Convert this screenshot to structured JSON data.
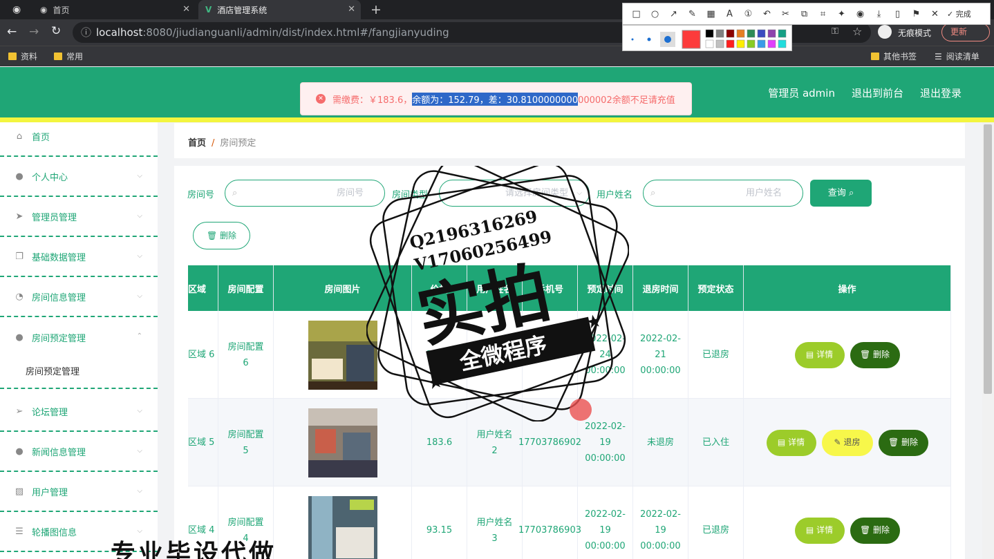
{
  "browser": {
    "tabs": [
      {
        "title": "首页"
      },
      {
        "title": "酒店管理系统"
      }
    ],
    "url_host": "localhost",
    "url_rest": ":8080/jiudianguanli/admin/dist/index.html#/fangjianyuding",
    "incognito_label": "无痕模式",
    "update_label": "更新",
    "bookmarks": [
      "资料",
      "常用"
    ],
    "bookmarks_right": [
      "其他书签",
      "阅读清单"
    ]
  },
  "snap_toolbar": {
    "done_label": "完成"
  },
  "header": {
    "user_label": "管理员 admin",
    "to_front_label": "退出到前台",
    "logout_label": "退出登录"
  },
  "alert": {
    "prefix": "需缴费：￥183.6，",
    "highlighted": "余额为：152.79，差：30.8100000000",
    "suffix": "000002余额不足请充值"
  },
  "sidebar": {
    "items": [
      {
        "label": "首页",
        "icon": "home-icon"
      },
      {
        "label": "个人中心",
        "icon": "user-icon"
      },
      {
        "label": "管理员管理",
        "icon": "send-icon"
      },
      {
        "label": "基础数据管理",
        "icon": "copy-icon"
      },
      {
        "label": "房间信息管理",
        "icon": "dashboard-icon"
      },
      {
        "label": "房间预定管理",
        "icon": "bulb-icon"
      },
      {
        "label": "论坛管理",
        "icon": "location-icon"
      },
      {
        "label": "新闻信息管理",
        "icon": "user-icon"
      },
      {
        "label": "用户管理",
        "icon": "chart-icon"
      },
      {
        "label": "轮播图信息",
        "icon": "list-icon"
      }
    ],
    "sub_item": "房间预定管理"
  },
  "breadcrumb": {
    "home": "首页",
    "current": "房间预定"
  },
  "filters": {
    "room_no_label": "房间号",
    "room_no_placeholder": "房间号",
    "room_type_label": "房间类型",
    "room_type_placeholder": "请选择房间类型",
    "user_name_label": "用户姓名",
    "user_name_placeholder": "用户姓名",
    "query_label": "查询",
    "delete_label": "删除"
  },
  "table": {
    "headers": [
      "区域",
      "房间配置",
      "房间图片",
      "价格",
      "用户姓名",
      "手机号",
      "预定时间",
      "退房时间",
      "预定状态",
      "操作"
    ],
    "rows": [
      {
        "area": "区域 6",
        "config": "房间配置 6",
        "price": "244.1",
        "user": "用户姓名",
        "phone": "6901",
        "book_time": "2022-02-24 00:00:00",
        "checkout": "2022-02-21 00:00:00",
        "status": "已退房",
        "actions": [
          "详情",
          "删除"
        ]
      },
      {
        "area": "区域 5",
        "config": "房间配置 5",
        "price": "183.6",
        "user": "用户姓名 2",
        "phone": "17703786902",
        "book_time": "2022-02-19 00:00:00",
        "checkout": "未退房",
        "status": "已入住",
        "actions": [
          "详情",
          "退房",
          "删除"
        ]
      },
      {
        "area": "区域 4",
        "config": "房间配置 4",
        "price": "93.15",
        "user": "用户姓名 3",
        "phone": "17703786903",
        "book_time": "2022-02-19 00:00:00",
        "checkout": "2022-02-19 00:00:00",
        "status": "已退房",
        "actions": [
          "详情",
          "删除"
        ]
      }
    ]
  },
  "watermark": {
    "line1": "Q2196316269",
    "line2": "V17060256499",
    "big": "实拍",
    "ribbon": "全微程序",
    "bottom": "专业毕设代做"
  }
}
